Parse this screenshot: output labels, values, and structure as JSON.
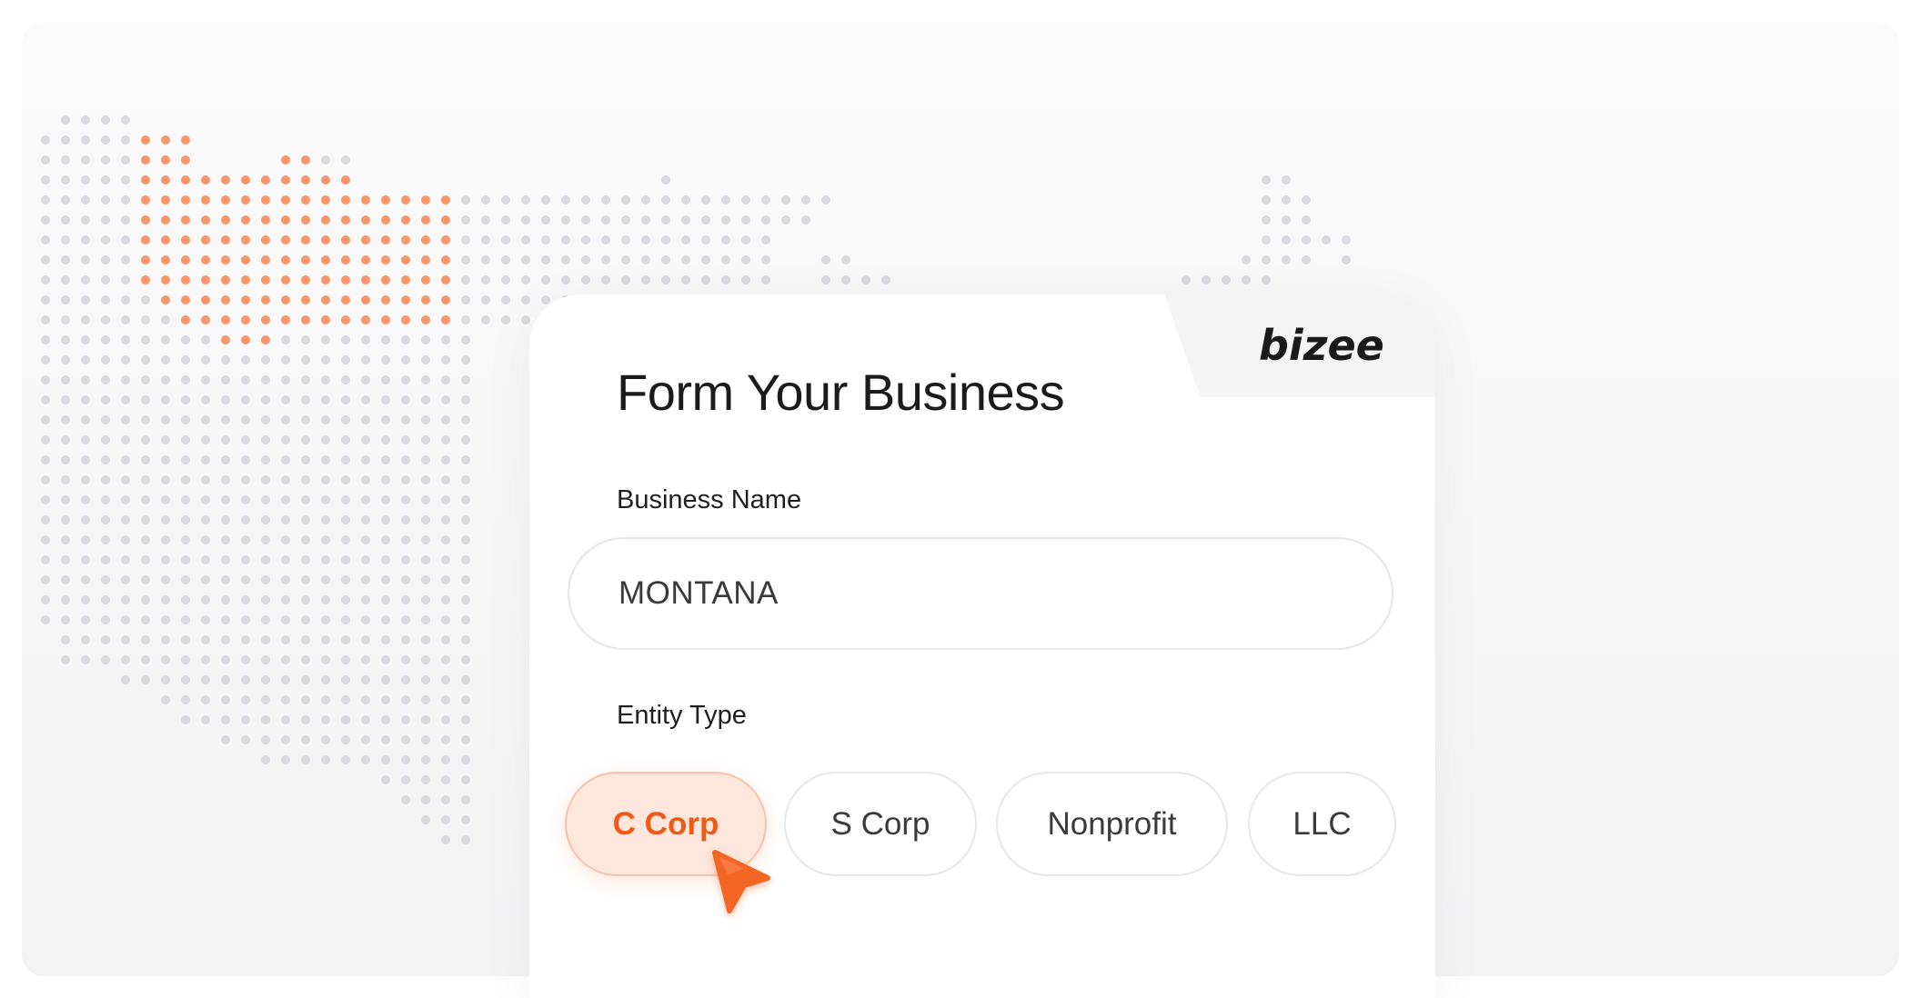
{
  "card": {
    "title": "Form Your Business",
    "logo_text": "bizee",
    "business_name_label": "Business Name",
    "business_name_value": "MONTANA",
    "entity_type_label": "Entity Type",
    "entity_options": [
      "C Corp",
      "S Corp",
      "Nonprofit",
      "LLC"
    ],
    "selected_entity": "C Corp"
  },
  "colors": {
    "accent": "#f05a17",
    "accent_bg": "#fde6dc",
    "map_highlight_dot": "#f7966a",
    "map_dot": "#d9dadf"
  },
  "map": {
    "highlighted_region": "Montana",
    "region": "United States"
  },
  "icons": {
    "cursor": "pointer-cursor-icon"
  }
}
